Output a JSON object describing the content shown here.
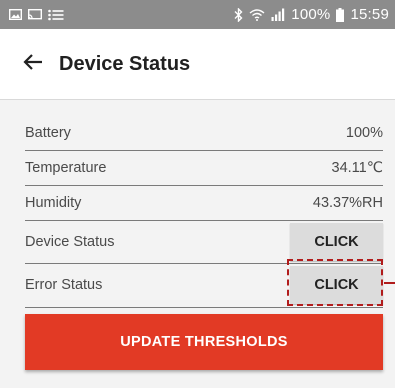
{
  "status_bar": {
    "battery_percent": "100%",
    "time": "15:59",
    "left_icons": [
      "image-icon",
      "cast-icon",
      "list-icon"
    ],
    "right_icons": [
      "bluetooth-icon",
      "wifi-icon",
      "signal-icon",
      "battery-icon"
    ]
  },
  "app_bar": {
    "back_icon": "arrow-left-icon",
    "title": "Device Status"
  },
  "rows": [
    {
      "label": "Battery",
      "value": "100%"
    },
    {
      "label": "Temperature",
      "value": "34.11℃"
    },
    {
      "label": "Humidity",
      "value": "43.37%RH"
    },
    {
      "label": "Device Status",
      "button": "CLICK"
    },
    {
      "label": "Error Status",
      "button": "CLICK"
    }
  ],
  "update_button": "UPDATE THRESHOLDS",
  "colors": {
    "status_bar": "#8c8c8c",
    "content_background": "#f3f3f3",
    "primary_button": "#e23a25",
    "highlight": "#b11c1c",
    "secondary_button": "#dcdcdc"
  }
}
